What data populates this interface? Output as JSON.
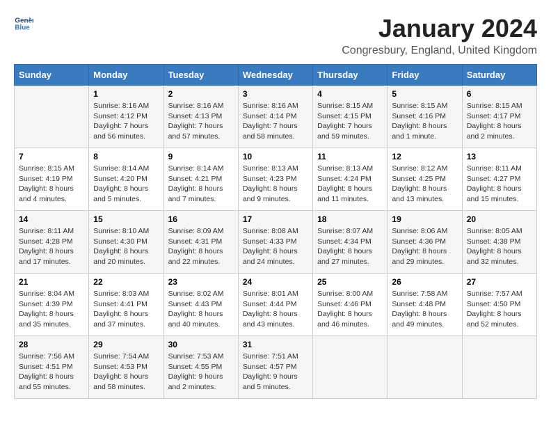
{
  "header": {
    "logo_line1": "General",
    "logo_line2": "Blue",
    "month": "January 2024",
    "location": "Congresbury, England, United Kingdom"
  },
  "weekdays": [
    "Sunday",
    "Monday",
    "Tuesday",
    "Wednesday",
    "Thursday",
    "Friday",
    "Saturday"
  ],
  "weeks": [
    [
      {
        "day": "",
        "info": ""
      },
      {
        "day": "1",
        "info": "Sunrise: 8:16 AM\nSunset: 4:12 PM\nDaylight: 7 hours\nand 56 minutes."
      },
      {
        "day": "2",
        "info": "Sunrise: 8:16 AM\nSunset: 4:13 PM\nDaylight: 7 hours\nand 57 minutes."
      },
      {
        "day": "3",
        "info": "Sunrise: 8:16 AM\nSunset: 4:14 PM\nDaylight: 7 hours\nand 58 minutes."
      },
      {
        "day": "4",
        "info": "Sunrise: 8:15 AM\nSunset: 4:15 PM\nDaylight: 7 hours\nand 59 minutes."
      },
      {
        "day": "5",
        "info": "Sunrise: 8:15 AM\nSunset: 4:16 PM\nDaylight: 8 hours\nand 1 minute."
      },
      {
        "day": "6",
        "info": "Sunrise: 8:15 AM\nSunset: 4:17 PM\nDaylight: 8 hours\nand 2 minutes."
      }
    ],
    [
      {
        "day": "7",
        "info": "Sunrise: 8:15 AM\nSunset: 4:19 PM\nDaylight: 8 hours\nand 4 minutes."
      },
      {
        "day": "8",
        "info": "Sunrise: 8:14 AM\nSunset: 4:20 PM\nDaylight: 8 hours\nand 5 minutes."
      },
      {
        "day": "9",
        "info": "Sunrise: 8:14 AM\nSunset: 4:21 PM\nDaylight: 8 hours\nand 7 minutes."
      },
      {
        "day": "10",
        "info": "Sunrise: 8:13 AM\nSunset: 4:23 PM\nDaylight: 8 hours\nand 9 minutes."
      },
      {
        "day": "11",
        "info": "Sunrise: 8:13 AM\nSunset: 4:24 PM\nDaylight: 8 hours\nand 11 minutes."
      },
      {
        "day": "12",
        "info": "Sunrise: 8:12 AM\nSunset: 4:25 PM\nDaylight: 8 hours\nand 13 minutes."
      },
      {
        "day": "13",
        "info": "Sunrise: 8:11 AM\nSunset: 4:27 PM\nDaylight: 8 hours\nand 15 minutes."
      }
    ],
    [
      {
        "day": "14",
        "info": "Sunrise: 8:11 AM\nSunset: 4:28 PM\nDaylight: 8 hours\nand 17 minutes."
      },
      {
        "day": "15",
        "info": "Sunrise: 8:10 AM\nSunset: 4:30 PM\nDaylight: 8 hours\nand 20 minutes."
      },
      {
        "day": "16",
        "info": "Sunrise: 8:09 AM\nSunset: 4:31 PM\nDaylight: 8 hours\nand 22 minutes."
      },
      {
        "day": "17",
        "info": "Sunrise: 8:08 AM\nSunset: 4:33 PM\nDaylight: 8 hours\nand 24 minutes."
      },
      {
        "day": "18",
        "info": "Sunrise: 8:07 AM\nSunset: 4:34 PM\nDaylight: 8 hours\nand 27 minutes."
      },
      {
        "day": "19",
        "info": "Sunrise: 8:06 AM\nSunset: 4:36 PM\nDaylight: 8 hours\nand 29 minutes."
      },
      {
        "day": "20",
        "info": "Sunrise: 8:05 AM\nSunset: 4:38 PM\nDaylight: 8 hours\nand 32 minutes."
      }
    ],
    [
      {
        "day": "21",
        "info": "Sunrise: 8:04 AM\nSunset: 4:39 PM\nDaylight: 8 hours\nand 35 minutes."
      },
      {
        "day": "22",
        "info": "Sunrise: 8:03 AM\nSunset: 4:41 PM\nDaylight: 8 hours\nand 37 minutes."
      },
      {
        "day": "23",
        "info": "Sunrise: 8:02 AM\nSunset: 4:43 PM\nDaylight: 8 hours\nand 40 minutes."
      },
      {
        "day": "24",
        "info": "Sunrise: 8:01 AM\nSunset: 4:44 PM\nDaylight: 8 hours\nand 43 minutes."
      },
      {
        "day": "25",
        "info": "Sunrise: 8:00 AM\nSunset: 4:46 PM\nDaylight: 8 hours\nand 46 minutes."
      },
      {
        "day": "26",
        "info": "Sunrise: 7:58 AM\nSunset: 4:48 PM\nDaylight: 8 hours\nand 49 minutes."
      },
      {
        "day": "27",
        "info": "Sunrise: 7:57 AM\nSunset: 4:50 PM\nDaylight: 8 hours\nand 52 minutes."
      }
    ],
    [
      {
        "day": "28",
        "info": "Sunrise: 7:56 AM\nSunset: 4:51 PM\nDaylight: 8 hours\nand 55 minutes."
      },
      {
        "day": "29",
        "info": "Sunrise: 7:54 AM\nSunset: 4:53 PM\nDaylight: 8 hours\nand 58 minutes."
      },
      {
        "day": "30",
        "info": "Sunrise: 7:53 AM\nSunset: 4:55 PM\nDaylight: 9 hours\nand 2 minutes."
      },
      {
        "day": "31",
        "info": "Sunrise: 7:51 AM\nSunset: 4:57 PM\nDaylight: 9 hours\nand 5 minutes."
      },
      {
        "day": "",
        "info": ""
      },
      {
        "day": "",
        "info": ""
      },
      {
        "day": "",
        "info": ""
      }
    ]
  ]
}
